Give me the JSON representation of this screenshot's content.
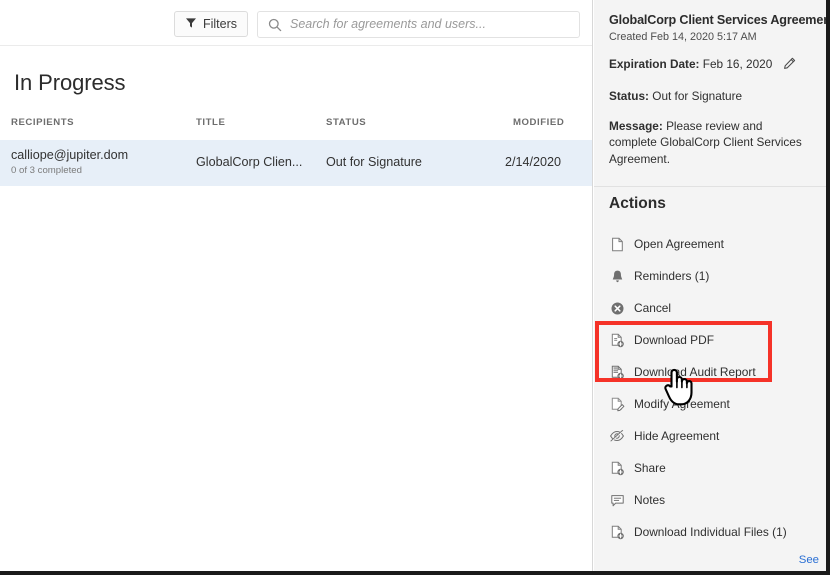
{
  "toolbar": {
    "filters_label": "Filters",
    "filters_icon": "funnel-icon",
    "search_icon": "search-icon",
    "search_placeholder": "Search for agreements and users...",
    "search_value": ""
  },
  "main": {
    "section_title": "In Progress",
    "columns": [
      "RECIPIENTS",
      "TITLE",
      "STATUS",
      "MODIFIED"
    ],
    "rows": [
      {
        "recipient": "calliope@jupiter.dom",
        "recipient_sub": "0 of 3 completed",
        "title": "GlobalCorp Clien...",
        "status": "Out for Signature",
        "modified": "2/14/2020",
        "selected": true
      }
    ]
  },
  "detail": {
    "title": "GlobalCorp Client Services Agreement",
    "created": "Created Feb 14, 2020 5:17 AM",
    "expiration_label": "Expiration Date:",
    "expiration_value": "Feb 16, 2020",
    "edit_icon": "pencil-icon",
    "status_label": "Status:",
    "status_value": "Out for Signature",
    "message_label": "Message:",
    "message_value": "Please review and complete GlobalCorp Client Services Agreement.",
    "see_link": "See"
  },
  "actions": {
    "heading": "Actions",
    "items": [
      {
        "label": "Open Agreement",
        "icon": "document-icon"
      },
      {
        "label": "Reminders (1)",
        "icon": "bell-icon"
      },
      {
        "label": "Cancel",
        "icon": "cancel-circle-icon"
      },
      {
        "label": "Download PDF",
        "icon": "document-download-icon"
      },
      {
        "label": "Download Audit Report",
        "icon": "audit-report-download-icon"
      },
      {
        "label": "Modify Agreement",
        "icon": "document-edit-icon"
      },
      {
        "label": "Hide Agreement",
        "icon": "eye-slash-icon"
      },
      {
        "label": "Share",
        "icon": "document-share-icon"
      },
      {
        "label": "Notes",
        "icon": "note-bubble-icon"
      },
      {
        "label": "Download Individual Files (1)",
        "icon": "document-download-icon"
      }
    ]
  },
  "annotation": {
    "highlight_color": "#f53228",
    "highlight_targets": [
      "Download PDF",
      "Download Audit Report"
    ],
    "cursor_icon": "pointing-hand-cursor"
  }
}
